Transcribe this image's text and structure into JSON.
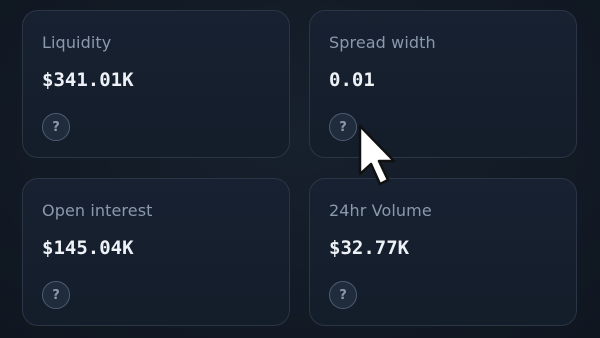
{
  "cards": [
    {
      "label": "Liquidity",
      "value": "$341.01K",
      "help_icon": "question-circle-icon",
      "help_glyph": "?"
    },
    {
      "label": "Spread width",
      "value": "0.01",
      "help_icon": "question-circle-icon",
      "help_glyph": "?"
    },
    {
      "label": "Open interest",
      "value": "$145.04K",
      "help_icon": "question-circle-icon",
      "help_glyph": "?"
    },
    {
      "label": "24hr Volume",
      "value": "$32.77K",
      "help_icon": "question-circle-icon",
      "help_glyph": "?"
    }
  ],
  "cursor": {
    "icon": "mouse-pointer-icon"
  },
  "colors": {
    "background": "#131b26",
    "card_background": "#162030",
    "card_border": "#2a3546",
    "label_text": "#8b99ad",
    "value_text": "#eef2f7",
    "help_icon": "#8d99ab"
  }
}
